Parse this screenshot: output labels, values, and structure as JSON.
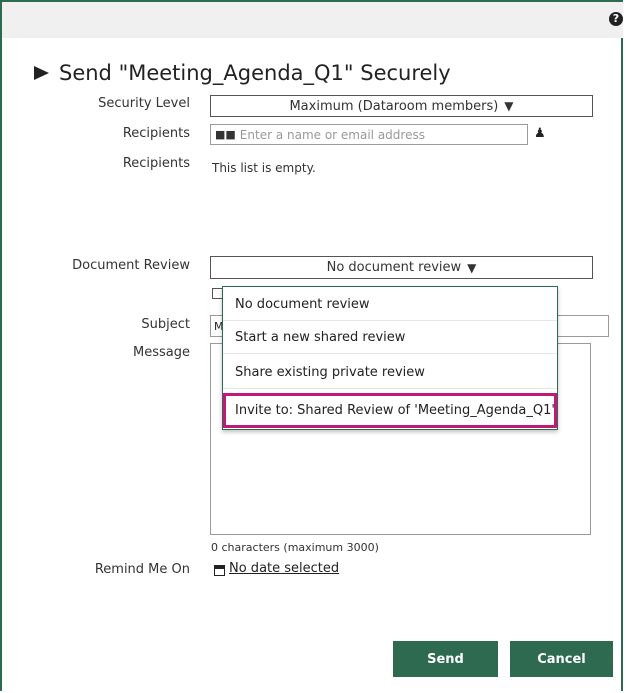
{
  "topbar": {
    "help_icon": "?"
  },
  "title": "Send \"Meeting_Agenda_Q1\" Securely",
  "labels": {
    "security_level": "Security Level",
    "recipients": "Recipients",
    "recipients_list": "Recipients",
    "document_review": "Document Review",
    "subject": "Subject",
    "message": "Message",
    "remind_me_on": "Remind Me On"
  },
  "security_level": {
    "value": "Maximum (Dataroom members)",
    "arrow": "▼"
  },
  "recipients_input": {
    "placeholder": "Enter a name or email address"
  },
  "recipients_list": {
    "empty_text": "This list is empty."
  },
  "document_review": {
    "value": "No document review",
    "arrow": "▼"
  },
  "subject_value": "Me",
  "dropdown": {
    "items": [
      "No document review",
      "Start a new shared review",
      "Share existing private review",
      "Invite to: Shared Review of 'Meeting_Agenda_Q1'"
    ]
  },
  "message_counter": "0 characters (maximum 3000)",
  "remind_date": "No date selected",
  "buttons": {
    "send": "Send",
    "cancel": "Cancel"
  },
  "colors": {
    "brand": "#2d6a4f",
    "highlight": "#c2187a"
  }
}
